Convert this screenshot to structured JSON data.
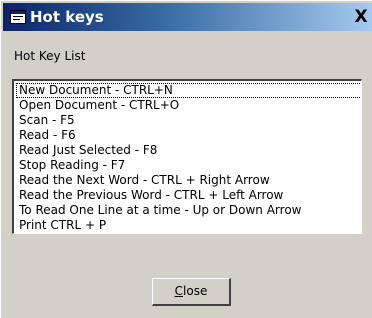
{
  "window": {
    "title": "Hot keys",
    "close_glyph": "X",
    "title_icon": "app-window-icon",
    "colors": {
      "titlebar_start": "#0a246a",
      "titlebar_end": "#a6caf0",
      "face": "#d4d0c8"
    }
  },
  "list": {
    "label": "Hot Key List",
    "items": [
      "New Document - CTRL+N",
      "Open Document - CTRL+O",
      "Scan - F5",
      "Read - F6",
      "Read Just Selected - F8",
      "Stop Reading - F7",
      "Read the Next Word - CTRL + Right Arrow",
      "Read the Previous Word - CTRL + Left Arrow",
      "To Read One Line at a time -  Up or Down Arrow",
      "Print CTRL + P"
    ]
  },
  "buttons": {
    "close_mnemonic": "C",
    "close_rest": "lose"
  }
}
